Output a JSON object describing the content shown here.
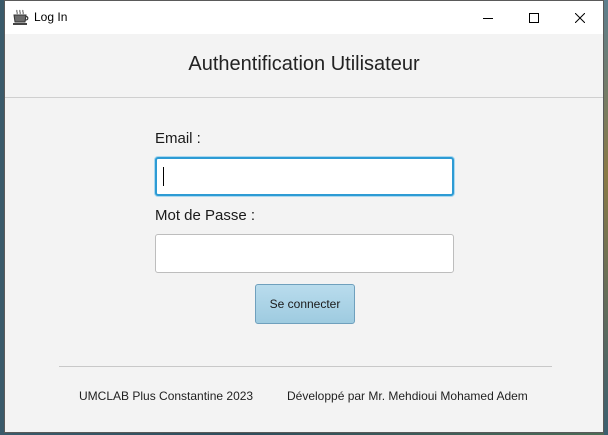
{
  "window": {
    "title": "Log In",
    "app_icon": "coffee-cup-icon"
  },
  "controls": {
    "minimize_icon": "minimize-icon",
    "maximize_icon": "maximize-icon",
    "close_icon": "close-icon"
  },
  "form": {
    "heading": "Authentification Utilisateur",
    "email_label": "Email :",
    "email_value": "",
    "email_focused": true,
    "password_label": "Mot de Passe :",
    "password_value": "",
    "submit_label": "Se connecter"
  },
  "footer": {
    "left_text": "UMCLAB Plus Constantine 2023",
    "right_text": "Développé par Mr. Mehdioui Mohamed Adem"
  },
  "colors": {
    "focus_border": "#2d9bd4",
    "button_fill": "#a9d3e7",
    "background": "#f3f3f3"
  }
}
